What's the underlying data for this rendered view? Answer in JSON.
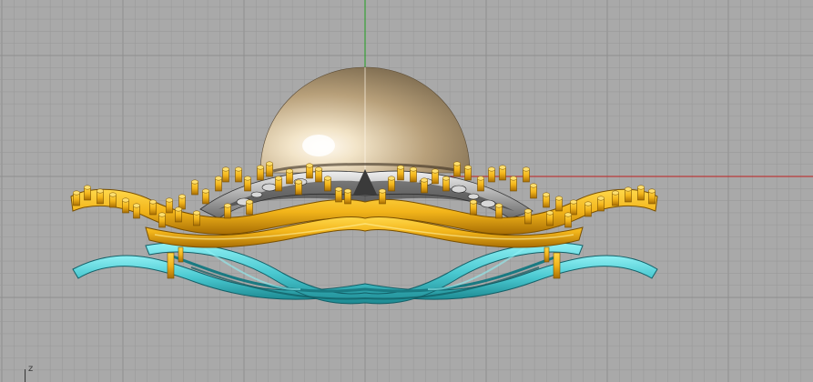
{
  "viewport": {
    "background_color": "#a9a9a9",
    "grid_line_color": "#9a9a9a",
    "grid_major_color": "#8e8e8e",
    "axis_x_color": "#c02020",
    "axis_y_color": "#20a020"
  },
  "axis_indicator": {
    "label": "z"
  },
  "model": {
    "gem_color": "#d9c8a8",
    "gem_highlight": "#fffaf0",
    "metal_gold": "#f2b41a",
    "metal_gold_shadow": "#b37a06",
    "metal_silver": "#c8c8c8",
    "metal_teal": "#49c8d0",
    "metal_teal_shadow": "#1f8f98"
  }
}
